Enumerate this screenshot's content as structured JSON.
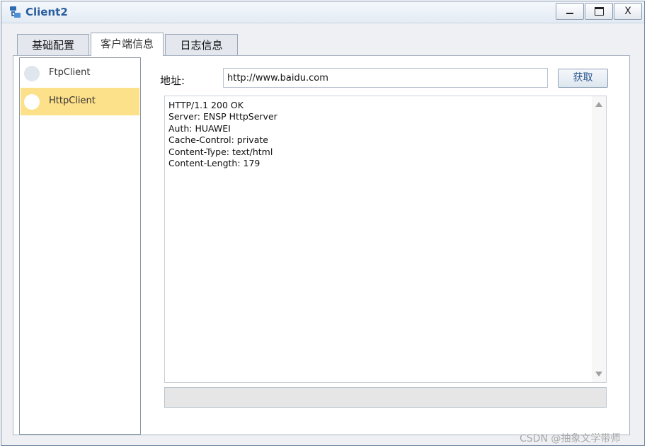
{
  "window": {
    "title": "Client2",
    "minimize_label": "",
    "maximize_label": "",
    "close_label": "X"
  },
  "tabs": [
    {
      "label": "基础配置",
      "active": false
    },
    {
      "label": "客户端信息",
      "active": true
    },
    {
      "label": "日志信息",
      "active": false
    }
  ],
  "sidebar": {
    "items": [
      {
        "label": "FtpClient",
        "selected": false
      },
      {
        "label": "HttpClient",
        "selected": true
      }
    ]
  },
  "form": {
    "address_label": "地址:",
    "address_value": "http://www.baidu.com",
    "fetch_label": "获取"
  },
  "response": {
    "text": "HTTP/1.1 200 OK\nServer: ENSP HttpServer\nAuth: HUAWEI\nCache-Control: private\nContent-Type: text/html\nContent-Length: 179"
  },
  "status_bar": {
    "text": ""
  },
  "watermark": "CSDN @抽象文学带师",
  "colors": {
    "title_text": "#2b5e9c",
    "selected_item": "#fde08a",
    "accent_button_text": "#2c5790"
  }
}
